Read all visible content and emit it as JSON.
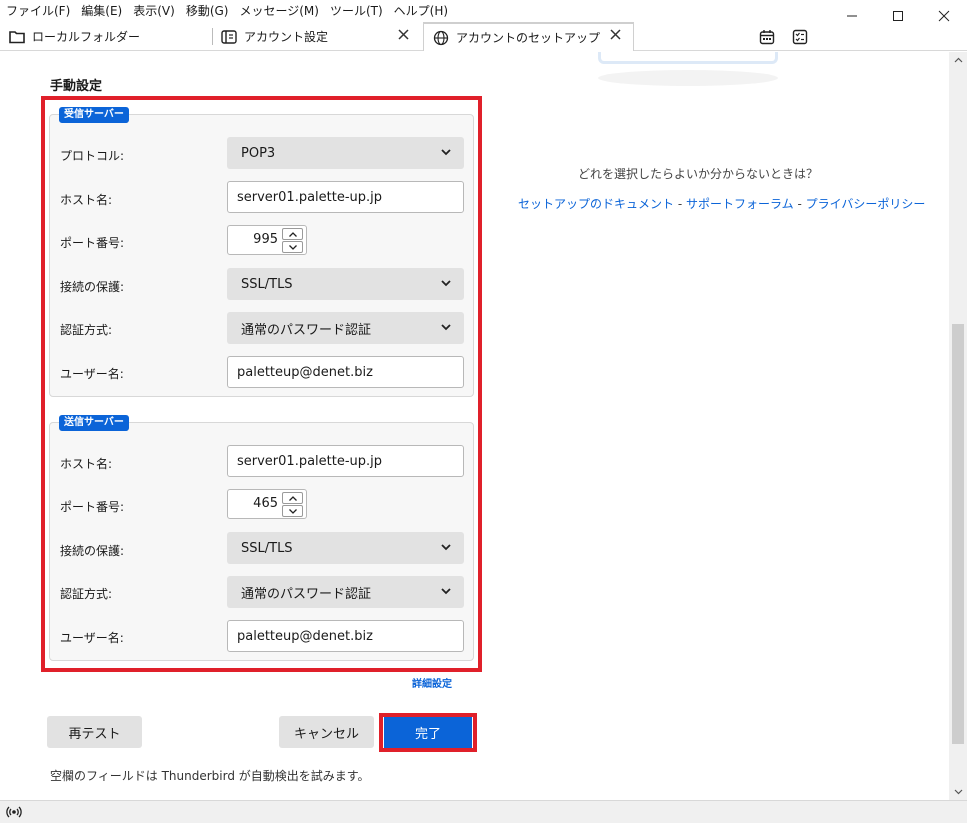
{
  "menubar": {
    "items": [
      "ファイル(F)",
      "編集(E)",
      "表示(V)",
      "移動(G)",
      "メッセージ(M)",
      "ツール(T)",
      "ヘルプ(H)"
    ]
  },
  "window_controls": {
    "minimize": "—",
    "maximize": "☐",
    "close": "✕"
  },
  "tabs": [
    {
      "label": "ローカルフォルダー",
      "icon": "folder-icon"
    },
    {
      "label": "アカウント設定",
      "icon": "settings-page-icon"
    },
    {
      "label": "アカウントのセットアップ",
      "icon": "globe-icon",
      "active": true
    }
  ],
  "tab_tools": [
    "calendar-icon",
    "tasks-icon"
  ],
  "manual": {
    "title": "手動設定",
    "incoming": {
      "legend": "受信サーバー",
      "protocol_label": "プロトコル:",
      "protocol_value": "POP3",
      "hostname_label": "ホスト名:",
      "hostname_value": "server01.palette-up.jp",
      "port_label": "ポート番号:",
      "port_value": "995",
      "security_label": "接続の保護:",
      "security_value": "SSL/TLS",
      "auth_label": "認証方式:",
      "auth_value": "通常のパスワード認証",
      "username_label": "ユーザー名:",
      "username_value": "paletteup@denet.biz"
    },
    "outgoing": {
      "legend": "送信サーバー",
      "hostname_label": "ホスト名:",
      "hostname_value": "server01.palette-up.jp",
      "port_label": "ポート番号:",
      "port_value": "465",
      "security_label": "接続の保護:",
      "security_value": "SSL/TLS",
      "auth_label": "認証方式:",
      "auth_value": "通常のパスワード認証",
      "username_label": "ユーザー名:",
      "username_value": "paletteup@denet.biz"
    },
    "advanced_link": "詳細設定",
    "retest_button": "再テスト",
    "cancel_button": "キャンセル",
    "done_button": "完了",
    "note": "空欄のフィールドは Thunderbird が自動検出を試みます。"
  },
  "help": {
    "question": "どれを選択したらよいか分からないときは？",
    "link_docs": "セットアップのドキュメント",
    "link_forum": "サポートフォーラム",
    "link_privacy": "プライバシーポリシー",
    "separator": " - "
  },
  "colors": {
    "accent": "#0b64d8",
    "highlight": "#e0202a"
  }
}
